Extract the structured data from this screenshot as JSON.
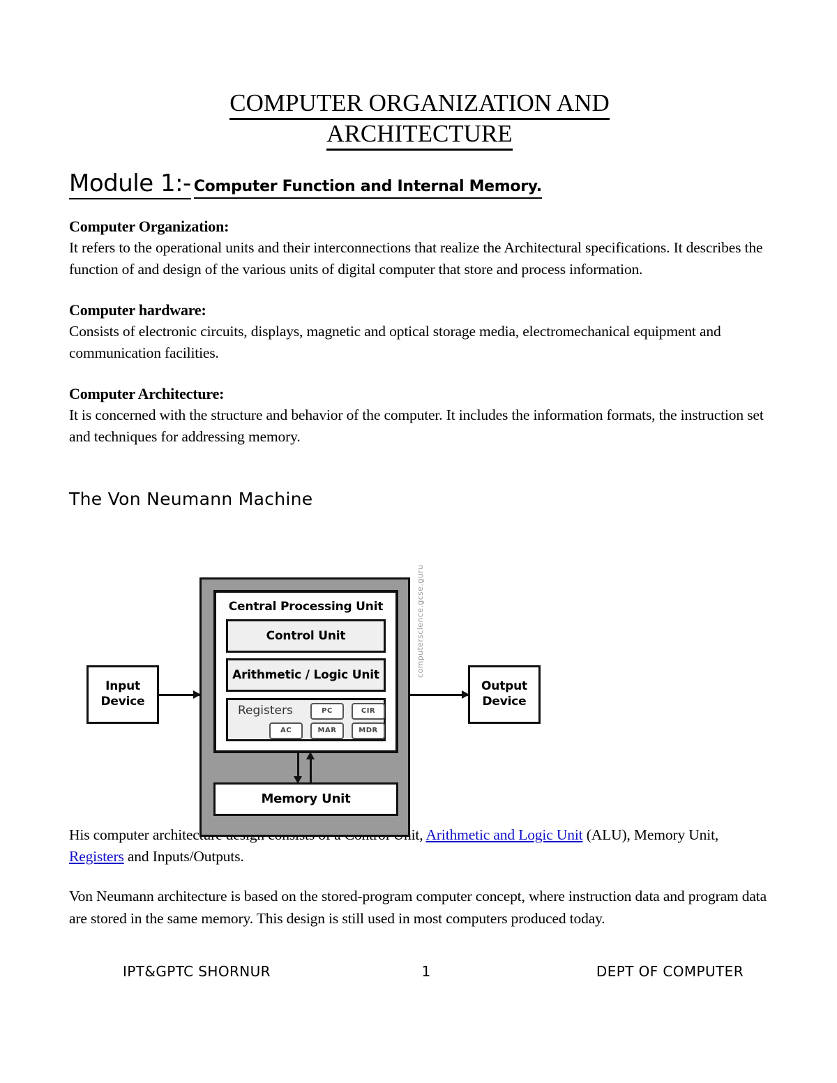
{
  "document": {
    "title_line_1": "COMPUTER ORGANIZATION AND",
    "title_line_2": "ARCHITECTURE",
    "module_heading_main": "Module 1:-",
    "module_heading_sub": "Computer Function and Internal Memory."
  },
  "sections": [
    {
      "heading": "Computer Organization:",
      "body": "It refers to the operational units and their interconnections that realize the Architectural specifications. It describes the function of and design of the various units of digital computer that store and process information."
    },
    {
      "heading": "Computer hardware:",
      "body": "Consists of electronic circuits, displays, magnetic and optical storage media, electromechanical equipment and communication facilities."
    },
    {
      "heading": "Computer Architecture:",
      "body": "It is concerned with the structure and behavior of the computer. It includes the information formats, the instruction set and techniques for addressing memory."
    }
  ],
  "von_neumann": {
    "section_heading": "The Von Neumann Machine",
    "diagram": {
      "cpu_title": "Central Processing Unit",
      "control_unit": "Control Unit",
      "alu": "Arithmetic / Logic Unit",
      "registers_label": "Registers",
      "registers": [
        "PC",
        "CIR",
        "AC",
        "MAR",
        "MDR"
      ],
      "memory_unit": "Memory Unit",
      "input_device_line1": "Input",
      "input_device_line2": "Device",
      "output_device_line1": "Output",
      "output_device_line2": "Device",
      "watermark": "computerscience.gcse.guru"
    },
    "paragraph_1": {
      "part_1": "His computer architecture design consists of a Control Unit, ",
      "link_1": "Arithmetic and Logic Unit",
      "part_2": " (ALU), Memory Unit, ",
      "link_2": "Registers",
      "part_3": " and Inputs/Outputs."
    },
    "paragraph_2": "Von Neumann architecture is based on the stored-program computer concept, where instruction data and program data are stored in the same memory.  This design is still used in most computers produced today."
  },
  "footer": {
    "left": "IPT&GPTC SHORNUR",
    "center": "1",
    "right": "DEPT OF COMPUTER"
  },
  "colors": {
    "link": "#1111cc",
    "diagram_outer_gray": "#9a9a9a",
    "diagram_unit_gray": "#efefef",
    "watermark_gray": "#9b9b9b"
  }
}
